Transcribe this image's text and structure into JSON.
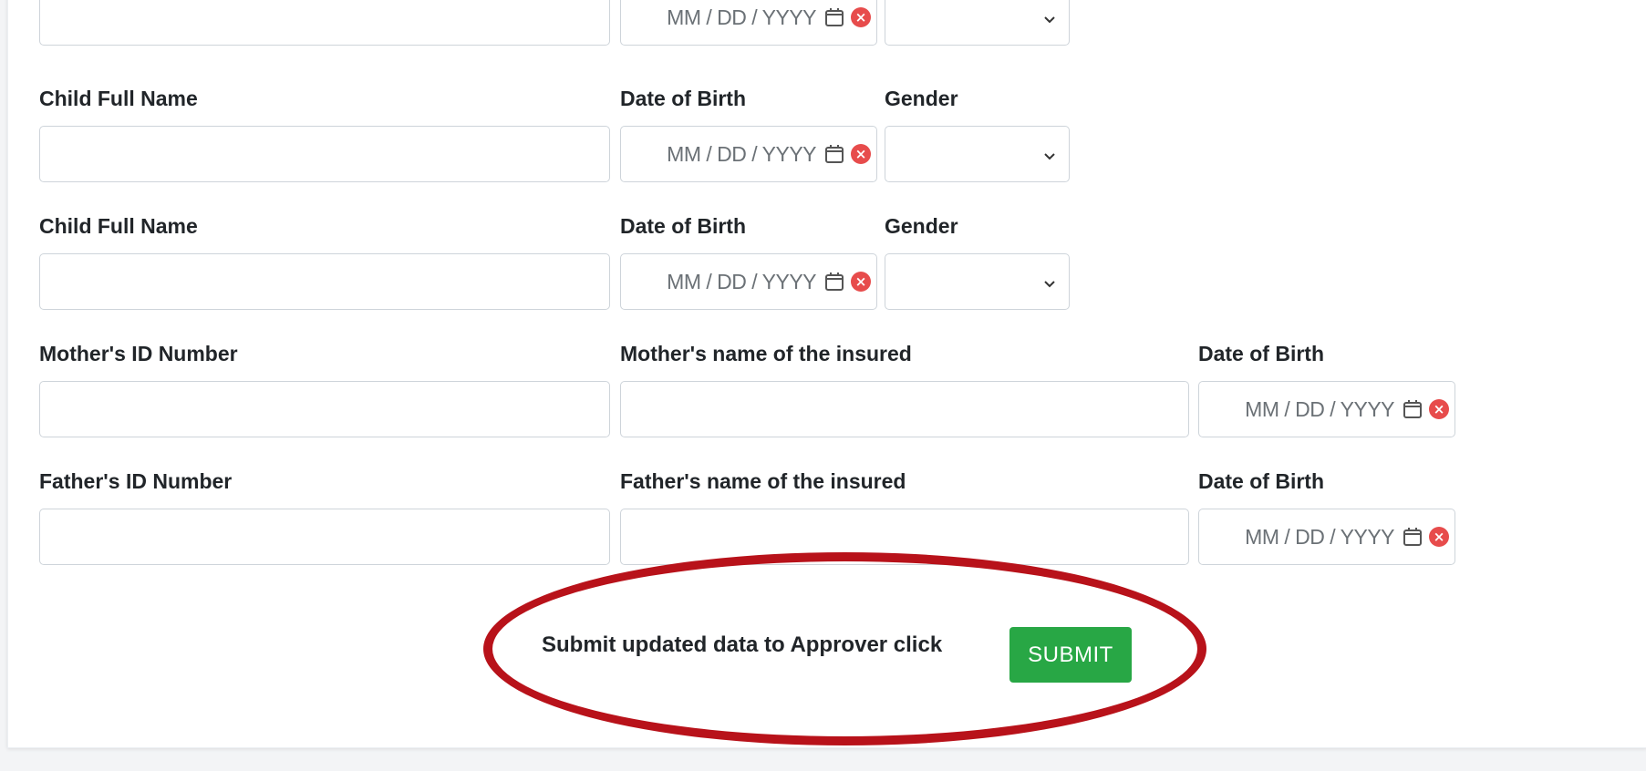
{
  "form": {
    "rows": [
      {
        "type": "child",
        "name_label": "",
        "dob_label": "",
        "gender_label": "",
        "name_value": "",
        "dob_placeholder": "MM / DD / YYYY",
        "gender_value": ""
      },
      {
        "type": "child",
        "name_label": "Child Full Name",
        "dob_label": "Date of Birth",
        "gender_label": "Gender",
        "name_value": "",
        "dob_placeholder": "MM / DD / YYYY",
        "gender_value": ""
      },
      {
        "type": "child",
        "name_label": "Child Full Name",
        "dob_label": "Date of Birth",
        "gender_label": "Gender",
        "name_value": "",
        "dob_placeholder": "MM / DD / YYYY",
        "gender_value": ""
      }
    ],
    "mother": {
      "id_label": "Mother's ID Number",
      "name_label": "Mother's name of the insured",
      "dob_label": "Date of Birth",
      "id_value": "",
      "name_value": "",
      "dob_placeholder": "MM / DD / YYYY"
    },
    "father": {
      "id_label": "Father's ID Number",
      "name_label": "Father's name of the insured",
      "dob_label": "Date of Birth",
      "id_value": "",
      "name_value": "",
      "dob_placeholder": "MM / DD / YYYY"
    },
    "submit": {
      "prompt": "Submit updated data to Approver click",
      "button_label": "SUBMIT"
    }
  },
  "icons": {
    "calendar": "calendar-icon",
    "clear": "clear-icon",
    "chevron": "chevron-down-icon"
  },
  "colors": {
    "submit_button": "#28a745",
    "clear_icon": "#e74c4c",
    "highlight_ellipse": "#b8121a",
    "border": "#ced4da"
  }
}
